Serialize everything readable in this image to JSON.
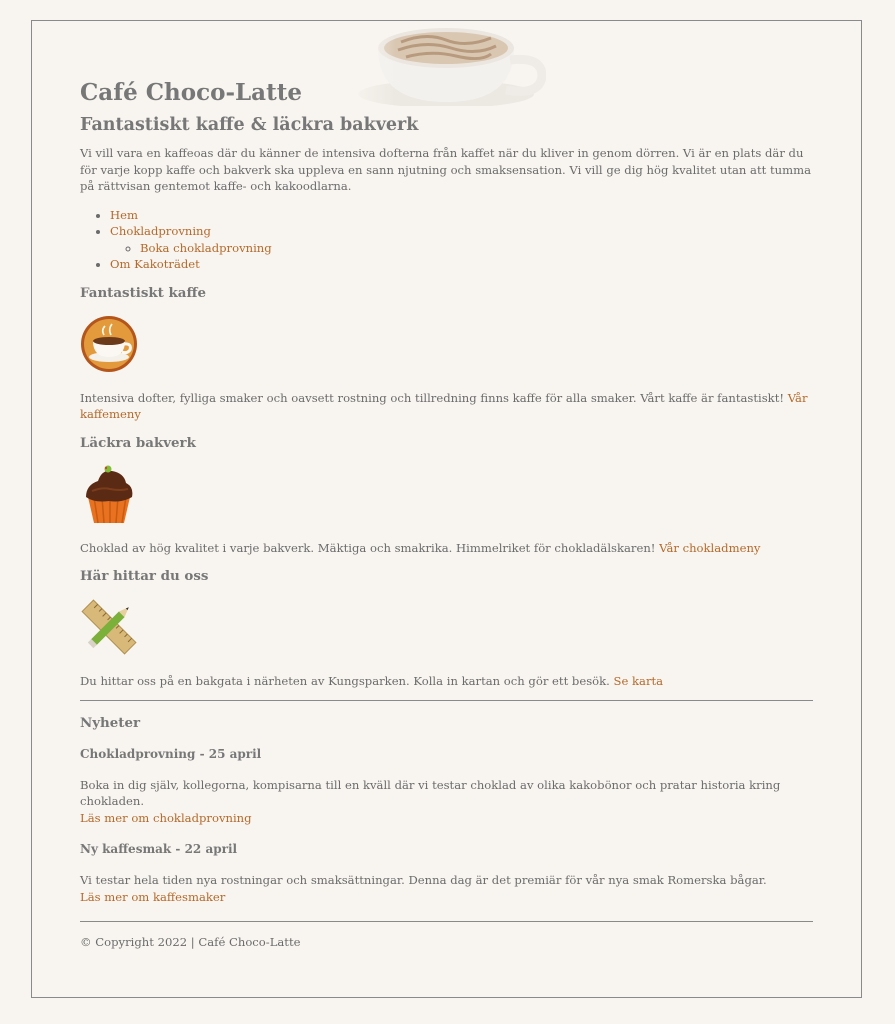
{
  "header": {
    "title": "Café Choco-Latte"
  },
  "main": {
    "subtitle": "Fantastiskt kaffe & läckra bakverk",
    "intro": "Vi vill vara en kaffeoas där du känner de intensiva dofterna från kaffet när du kliver in genom dörren. Vi är en plats där du för varje kopp kaffe och bakverk ska uppleva en sann njutning och smaksensation. Vi vill ge dig hög kvalitet utan att tumma på rättvisan gentemot kaffe- och kakoodlarna."
  },
  "nav": {
    "items": [
      {
        "label": "Hem"
      },
      {
        "label": "Chokladprovning",
        "children": [
          {
            "label": "Boka chokladprovning"
          }
        ]
      },
      {
        "label": "Om Kakoträdet"
      }
    ]
  },
  "sections": [
    {
      "heading": "Fantastiskt kaffe",
      "icon": "coffee-cup-icon",
      "text": "Intensiva dofter, fylliga smaker och oavsett rostning och tillredning finns kaffe för alla smaker. Vårt kaffe är fantastiskt!",
      "link": "Vår kaffemeny"
    },
    {
      "heading": "Läckra bakverk",
      "icon": "cupcake-icon",
      "text": "Choklad av hög kvalitet i varje bakverk. Mäktiga och smakrika. Himmelriket för chokladälskaren!",
      "link": "Vår chokladmeny"
    },
    {
      "heading": "Här hittar du oss",
      "icon": "ruler-pencil-icon",
      "text": "Du hittar oss på en bakgata i närheten av Kungsparken. Kolla in kartan och gör ett besök.",
      "link": "Se karta"
    }
  ],
  "news": {
    "title": "Nyheter",
    "items": [
      {
        "head": "Chokladprovning - 25 april",
        "body": "Boka in dig själv, kollegorna, kompisarna till en kväll där vi testar choklad av olika kakobönor och pratar historia kring chokladen.",
        "link": "Läs mer om chokladprovning"
      },
      {
        "head": "Ny kaffesmak - 22 april",
        "body": "Vi testar hela tiden nya rostningar och smaksättningar. Denna dag är det premiär för vår nya smak Romerska bågar.",
        "link": "Läs mer om kaffesmaker"
      }
    ]
  },
  "footer": {
    "copyright": "© Copyright 2022 | Café Choco-Latte"
  },
  "colors": {
    "background": "#f8f5f0",
    "text": "#6b6b6b",
    "link": "#b5692a",
    "border": "#8a8a8a"
  }
}
